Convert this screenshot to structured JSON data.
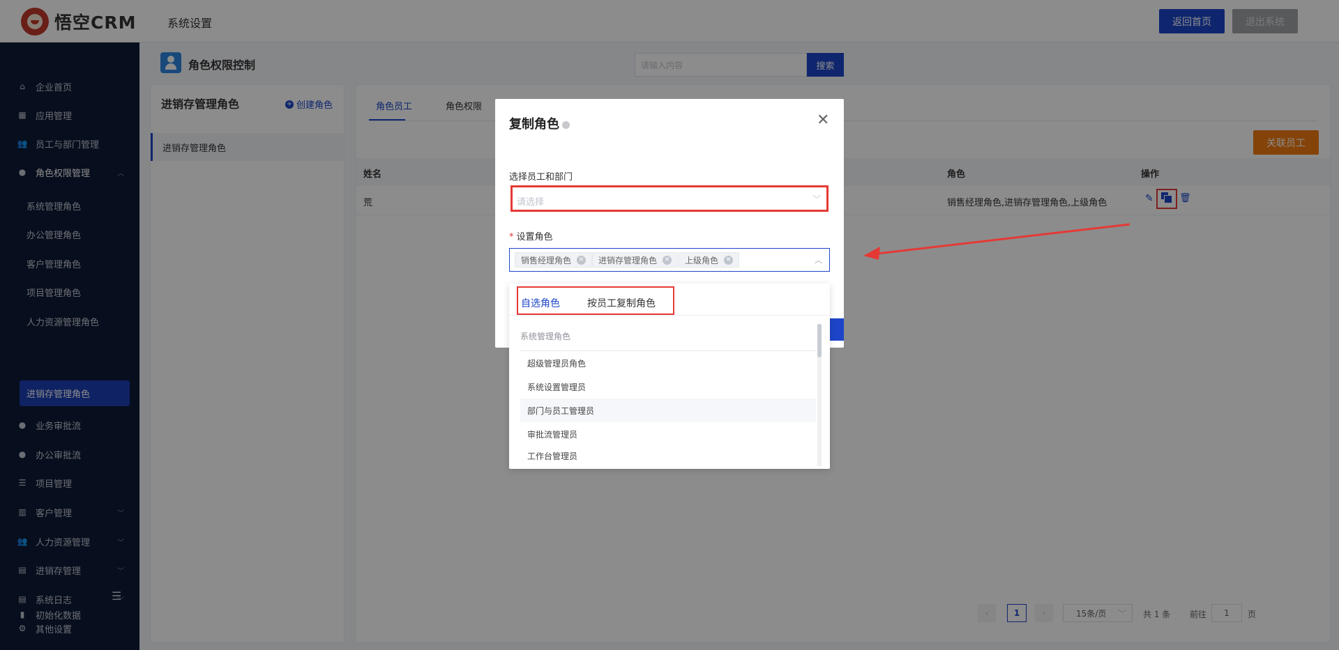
{
  "header": {
    "logo_text": "悟空CRM",
    "section_title": "系统设置",
    "home_button": "返回首页",
    "logout_button": "退出系统"
  },
  "sidebar": {
    "items": [
      {
        "label": "企业首页",
        "icon": "home-icon"
      },
      {
        "label": "应用管理",
        "icon": "grid-icon"
      },
      {
        "label": "员工与部门管理",
        "icon": "users-icon"
      },
      {
        "label": "角色权限管理",
        "icon": "user-icon",
        "expanded": true
      },
      {
        "label": "业务审批流",
        "icon": "user-icon"
      },
      {
        "label": "办公审批流",
        "icon": "user-icon"
      },
      {
        "label": "项目管理",
        "icon": "list-icon"
      },
      {
        "label": "客户管理",
        "icon": "building-icon"
      },
      {
        "label": "人力资源管理",
        "icon": "users-icon"
      },
      {
        "label": "进销存管理",
        "icon": "truck-icon"
      },
      {
        "label": "系统日志",
        "icon": "doc-icon"
      },
      {
        "label": "其他设置",
        "icon": "gear-icon"
      },
      {
        "label": "初始化数据",
        "icon": "chart-icon"
      }
    ],
    "sub_items": [
      "系统管理角色",
      "办公管理角色",
      "客户管理角色",
      "项目管理角色",
      "人力资源管理角色",
      "进销存管理角色"
    ],
    "active_sub": "进销存管理角色"
  },
  "content": {
    "title": "角色权限控制",
    "search_placeholder": "请输入内容",
    "search_button": "搜索"
  },
  "role_panel": {
    "title": "进销存管理角色",
    "create_label": "创建角色",
    "selected_role": "进销存管理角色"
  },
  "right_panel": {
    "tabs": [
      "角色员工",
      "角色权限"
    ],
    "link_button": "关联员工",
    "columns": [
      "姓名",
      "角色",
      "操作"
    ],
    "rows": [
      {
        "name": "荒",
        "roles": "销售经理角色,进销存管理角色,上级角色"
      }
    ],
    "pager": {
      "current": "1",
      "page_size": "15条/页",
      "total": "共 1 条",
      "goto_label": "前往",
      "goto_value": "1",
      "page_suffix": "页"
    }
  },
  "dialog": {
    "title": "复制角色",
    "select_label": "选择员工和部门",
    "select_placeholder": "请选择",
    "role_label": "设置角色",
    "required_mark": "*",
    "tags": [
      "销售经理角色",
      "进销存管理角色",
      "上级角色"
    ]
  },
  "dropdown": {
    "tab_active": "自选角色",
    "tab_other": "按员工复制角色",
    "group": "系统管理角色",
    "options": [
      "超级管理员角色",
      "系统设置管理员",
      "部门与员工管理员",
      "审批流管理员",
      "工作台管理员"
    ]
  },
  "colors": {
    "primary": "#1c45c9",
    "sidebar_bg": "#0e1a36",
    "accent_orange": "#f07a11",
    "annotation_red": "#e53935"
  }
}
